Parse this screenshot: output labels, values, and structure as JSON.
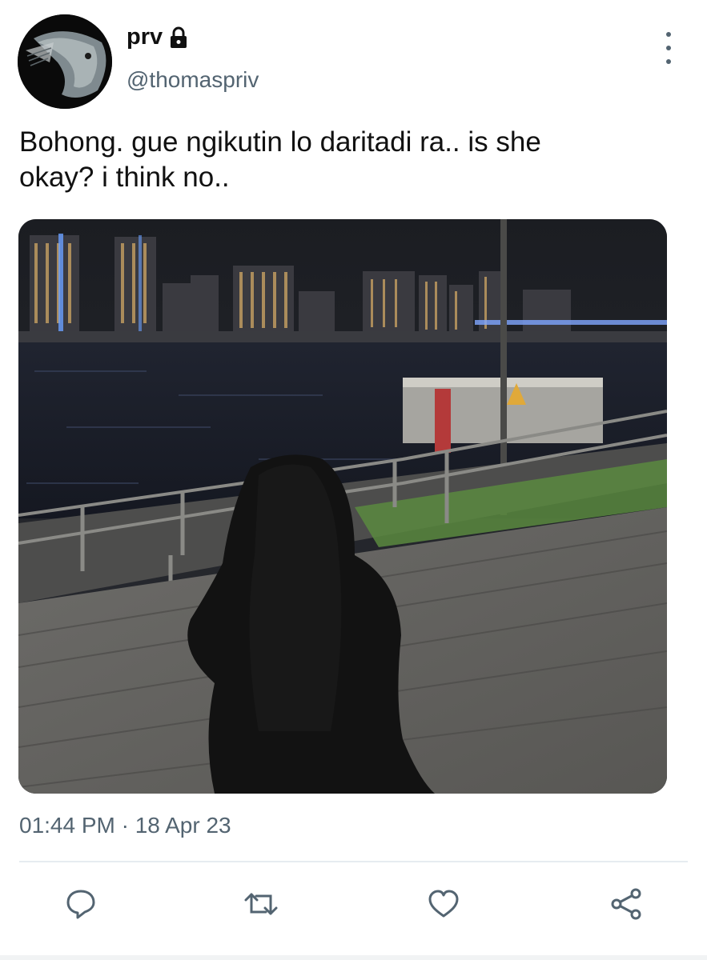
{
  "tweet": {
    "display_name": "prv",
    "handle": "@thomaspriv",
    "text_line1": "Bohong. gue ngikutin lo daritadi ra.. is she",
    "text_line2": "okay? i think no..",
    "timestamp": "01:44 PM · 18 Apr 23"
  },
  "icons": {
    "lock": "lock-icon",
    "more": "more-vertical-icon",
    "reply": "reply-icon",
    "retweet": "retweet-icon",
    "like": "heart-icon",
    "share": "share-icon"
  },
  "colors": {
    "text_primary": "#111111",
    "text_secondary": "#536471",
    "divider": "#e6ecf0"
  }
}
